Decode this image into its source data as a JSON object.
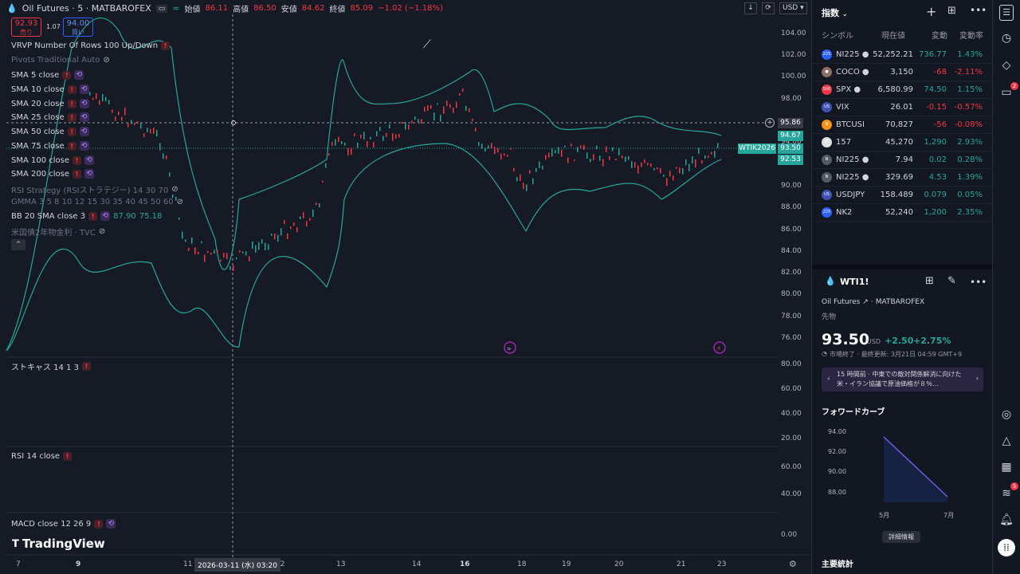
{
  "header": {
    "title": "Oil Futures · 5 · MATBAROFEX",
    "open_label": "始値",
    "open": "86.11",
    "high_label": "高値",
    "high": "86.50",
    "low_label": "安値",
    "low": "84.62",
    "close_label": "終値",
    "close": "85.09",
    "change": "−1.02 (−1.18%)",
    "currency": "USD"
  },
  "trade": {
    "sell_price": "92.93",
    "sell_label": "売り",
    "spread": "1.07",
    "buy_price": "94.00",
    "buy_label": "買い"
  },
  "indicators": [
    {
      "label": "VRVP Number Of Rows 100 Up/Down",
      "dim": false
    },
    {
      "label": "Pivots Traditional Auto",
      "dim": true
    },
    {
      "label": "SMA 5 close",
      "dim": false
    },
    {
      "label": "SMA 10 close",
      "dim": false
    },
    {
      "label": "SMA 20 close",
      "dim": false
    },
    {
      "label": "SMA 25 close",
      "dim": false
    },
    {
      "label": "SMA 50 close",
      "dim": false
    },
    {
      "label": "SMA 75 close",
      "dim": false
    },
    {
      "label": "SMA 100 close",
      "dim": false
    },
    {
      "label": "SMA 200 close",
      "dim": false
    },
    {
      "label": "RSI Strategy (RSIストラテジー) 14 30 70",
      "dim": true
    },
    {
      "label": "GMMA 3 5 8 10 12 15 30 35 40 45 50 60",
      "dim": true
    },
    {
      "label": "BB 20 SMA close 3",
      "dim": false
    },
    {
      "label": "米国債2年物金利 · TVC",
      "dim": true
    }
  ],
  "bb_values": {
    "a": "87.90",
    "b": "75.18"
  },
  "price_axis": [
    "104.00",
    "102.00",
    "100.00",
    "98.00",
    "96.00",
    "94.00",
    "92.00",
    "90.00",
    "88.00",
    "86.00",
    "84.00",
    "82.00",
    "80.00",
    "78.00",
    "76.00"
  ],
  "price_labels": {
    "crosshair": "95.86",
    "upper": "94.67",
    "symbol": "WTIK2026",
    "last": "93.50",
    "lower": "92.53"
  },
  "stoch": {
    "label": "ストキャス 14 1 3",
    "axis": [
      "80.00",
      "60.00",
      "40.00",
      "20.00"
    ]
  },
  "rsi": {
    "label": "RSI 14 close",
    "axis": [
      "60.00",
      "40.00"
    ]
  },
  "macd": {
    "label": "MACD close 12 26 9",
    "axis": [
      "0.00"
    ]
  },
  "logo": "TradingView",
  "time_axis": [
    "7",
    "9",
    "11",
    "12",
    "13",
    "14",
    "16",
    "18",
    "19",
    "20",
    "21",
    "23"
  ],
  "time_cursor": "2026-03-11 (水)   03:20",
  "watchlist": {
    "title": "指数",
    "headers": {
      "symbol": "シンボル",
      "price": "現在値",
      "change": "変動",
      "pct": "変動率"
    },
    "rows": [
      {
        "icon": "225",
        "icon_color": "#2962ff",
        "symbol": "NI225 ●",
        "price": "52,252.21",
        "change": "736.77",
        "pct": "1.43%",
        "dir": "pos"
      },
      {
        "icon": "●",
        "icon_color": "#8d6e63",
        "symbol": "COCO ●",
        "price": "3,150",
        "change": "-68",
        "pct": "-2.11%",
        "dir": "neg"
      },
      {
        "icon": "500",
        "icon_color": "#f23645",
        "symbol": "SPX ●",
        "price": "6,580.99",
        "change": "74.50",
        "pct": "1.15%",
        "dir": "pos"
      },
      {
        "icon": "US",
        "icon_color": "#3f51b5",
        "symbol": "VIX",
        "price": "26.01",
        "change": "-0.15",
        "pct": "-0.57%",
        "dir": "neg"
      },
      {
        "icon": "B",
        "icon_color": "#f7931a",
        "symbol": "BTCUSI",
        "price": "70,827",
        "change": "-56",
        "pct": "-0.08%",
        "dir": "neg"
      },
      {
        "icon": "JP",
        "icon_color": "#e0e0e0",
        "symbol": "157",
        "price": "45,270",
        "change": "1,290",
        "pct": "2.93%",
        "dir": "pos"
      },
      {
        "icon": "N",
        "icon_color": "#555a66",
        "symbol": "NI225 ●",
        "price": "7.94",
        "change": "0.02",
        "pct": "0.28%",
        "dir": "pos"
      },
      {
        "icon": "N",
        "icon_color": "#555a66",
        "symbol": "NI225 ●",
        "price": "329.69",
        "change": "4.53",
        "pct": "1.39%",
        "dir": "pos"
      },
      {
        "icon": "US",
        "icon_color": "#3f51b5",
        "symbol": "USDJPY",
        "price": "158.489",
        "change": "0.079",
        "pct": "0.05%",
        "dir": "pos"
      },
      {
        "icon": "225",
        "icon_color": "#2962ff",
        "symbol": "NK2",
        "price": "52,240",
        "change": "1,200",
        "pct": "2.35%",
        "dir": "pos"
      }
    ]
  },
  "detail": {
    "symbol": "WTI1!",
    "name": "Oil Futures",
    "exchange": "MATBAROFEX",
    "type": "先物",
    "price": "93.50",
    "currency": "USD",
    "change": "+2.50",
    "pct": "+2.75%",
    "status": "市場終了 · 最終更新: 3月21日 04:59 GMT+9",
    "news": "15 時間前 · 中東での敵対関係解消に向けた米・イラン協議で原油価格が８％…",
    "forward_title": "フォワードカーブ",
    "forward_axis": [
      "94.00",
      "92.00",
      "90.00",
      "88.00"
    ],
    "forward_months": [
      "5月",
      "7月"
    ],
    "details_button": "詳細情報",
    "stats_title": "主要統計"
  },
  "strip_badges": {
    "chat": "2",
    "feed": "5"
  }
}
